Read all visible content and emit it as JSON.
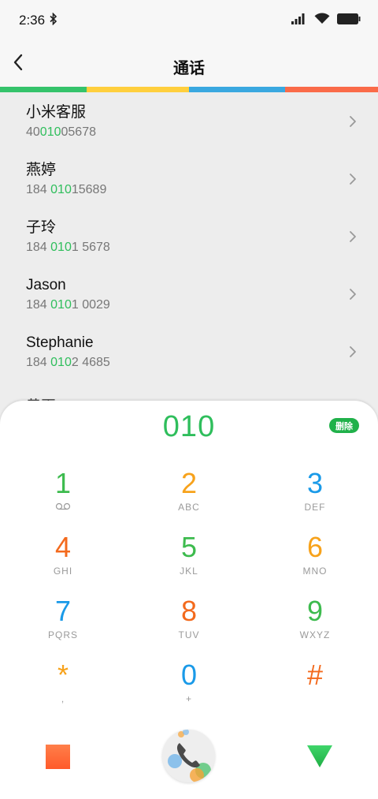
{
  "status": {
    "time": "2:36",
    "icons": [
      "bluetooth-icon",
      "signal-icon",
      "wifi-icon",
      "battery-icon"
    ]
  },
  "header": {
    "title": "通话",
    "back_icon": "chevron-left-icon"
  },
  "accent_colors": [
    "#35c36b",
    "#ffcf3d",
    "#3aa8e0",
    "#fa6b49"
  ],
  "contacts": [
    {
      "name": "小米客服",
      "number_pre": "40",
      "number_hl": "010",
      "number_post": "05678"
    },
    {
      "name": "燕婷",
      "number_pre": "184 ",
      "number_hl": "010",
      "number_post": "15689"
    },
    {
      "name": "子玲",
      "number_pre": "184 ",
      "number_hl": "010",
      "number_post": "1 5678"
    },
    {
      "name": "Jason",
      "number_pre": "184 ",
      "number_hl": "010",
      "number_post": "1 0029"
    },
    {
      "name": "Stephanie",
      "number_pre": "184 ",
      "number_hl": "010",
      "number_post": "2 4685"
    }
  ],
  "partial_contact": "黄再",
  "dialpad": {
    "input": "010",
    "delete_label": "删除",
    "keys": [
      [
        {
          "digit": "1",
          "letters": "",
          "color": "#3dbb4e"
        },
        {
          "digit": "2",
          "letters": "ABC",
          "color": "#f7a21b"
        },
        {
          "digit": "3",
          "letters": "DEF",
          "color": "#1a9ae8"
        }
      ],
      [
        {
          "digit": "4",
          "letters": "GHI",
          "color": "#f36a1d"
        },
        {
          "digit": "5",
          "letters": "JKL",
          "color": "#3dbb4e"
        },
        {
          "digit": "6",
          "letters": "MNO",
          "color": "#f7a21b"
        }
      ],
      [
        {
          "digit": "7",
          "letters": "PQRS",
          "color": "#1a9ae8"
        },
        {
          "digit": "8",
          "letters": "TUV",
          "color": "#f36a1d"
        },
        {
          "digit": "9",
          "letters": "WXYZ",
          "color": "#3dbb4e"
        }
      ],
      [
        {
          "digit": "*",
          "letters": ",",
          "color": "#f7a21b"
        },
        {
          "digit": "0",
          "letters": "+",
          "color": "#1a9ae8"
        },
        {
          "digit": "#",
          "letters": "",
          "color": "#f36a1d"
        }
      ]
    ]
  },
  "bottom": {
    "left_icon": "square-icon",
    "call_icon": "phone-icon",
    "right_icon": "triangle-down-icon"
  }
}
